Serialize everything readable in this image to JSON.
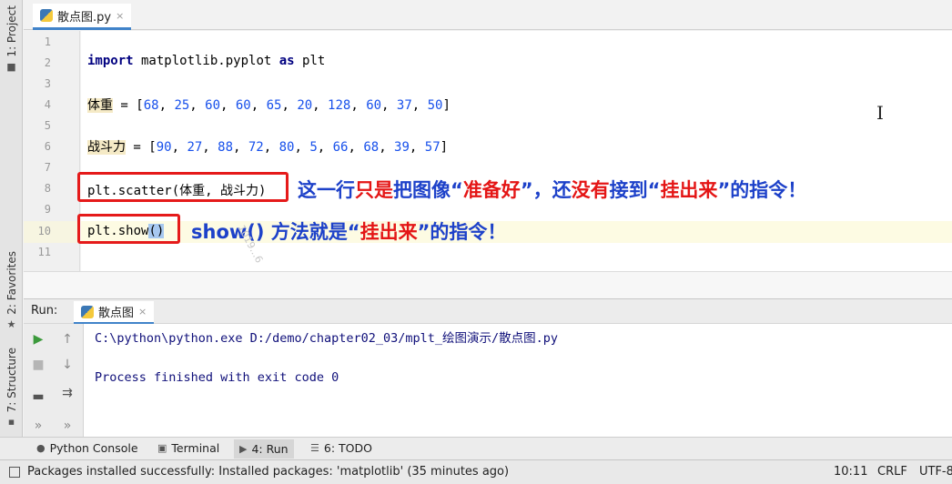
{
  "left_stripe": {
    "project_label": "1: Project",
    "favorites_label": "2: Favorites",
    "structure_label": "7: Structure"
  },
  "editor_tab": {
    "label": "散点图.py",
    "close": "×"
  },
  "line_numbers": [
    "1",
    "2",
    "3",
    "4",
    "5",
    "6",
    "7",
    "8",
    "9",
    "10",
    "11"
  ],
  "code": {
    "line2": {
      "kw1": "import",
      "mid": " matplotlib.pyplot ",
      "kw2": "as",
      "tail": " plt"
    },
    "line4": {
      "name": "体重",
      "eq": " = [",
      "values": [
        "68",
        "25",
        "60",
        "60",
        "65",
        "20",
        "128",
        "60",
        "37",
        "50"
      ],
      "close": "]"
    },
    "line6": {
      "name": "战斗力",
      "eq": " = [",
      "values": [
        "90",
        "27",
        "88",
        "72",
        "80",
        "5",
        "66",
        "68",
        "39",
        "57"
      ],
      "close": "]"
    },
    "line8": "plt.scatter(体重, 战斗力)",
    "line10": {
      "pre": "plt.show",
      "paren": "()"
    }
  },
  "annotations": {
    "scatter": [
      {
        "text": "这一行",
        "color": "blue"
      },
      {
        "text": "只是",
        "color": "red"
      },
      {
        "text": "把图像“",
        "color": "blue"
      },
      {
        "text": "准备好",
        "color": "red"
      },
      {
        "text": "”，还",
        "color": "blue"
      },
      {
        "text": "没有",
        "color": "red"
      },
      {
        "text": "接到“",
        "color": "blue"
      },
      {
        "text": "挂出来",
        "color": "red"
      },
      {
        "text": "”的指令！",
        "color": "blue"
      }
    ],
    "show": [
      {
        "text": "show() 方法就是“",
        "color": "blue"
      },
      {
        "text": "挂出来",
        "color": "red"
      },
      {
        "text": "”的指令！",
        "color": "blue"
      }
    ]
  },
  "watermark": "1019...6",
  "run_panel": {
    "title": "Run:",
    "tab_label": "散点图",
    "tab_close": "×",
    "console_lines": [
      "C:\\python\\python.exe D:/demo/chapter02_03/mplt_绘图演示/散点图.py",
      "Process finished with exit code 0"
    ]
  },
  "bottom_tabs": {
    "python_console": "Python Console",
    "terminal": "Terminal",
    "run": "4: Run",
    "todo": "6: TODO"
  },
  "status": {
    "message": "Packages installed successfully: Installed packages: 'matplotlib' (35 minutes ago)",
    "position": "10:11",
    "line_sep": "CRLF",
    "encoding": "UTF-8"
  },
  "colors": {
    "accent": "#4083c9",
    "annotation_blue": "#1d41c9",
    "annotation_red": "#e41515",
    "box_red": "#e51a1a"
  },
  "icons": [
    "python-file-icon",
    "run-icon",
    "stop-icon",
    "up-arrow-icon",
    "down-arrow-icon",
    "soft-wrap-icon",
    "layout-icon",
    "more-icon",
    "star-icon",
    "folder-icon",
    "structure-icon",
    "terminal-icon",
    "todo-icon"
  ]
}
